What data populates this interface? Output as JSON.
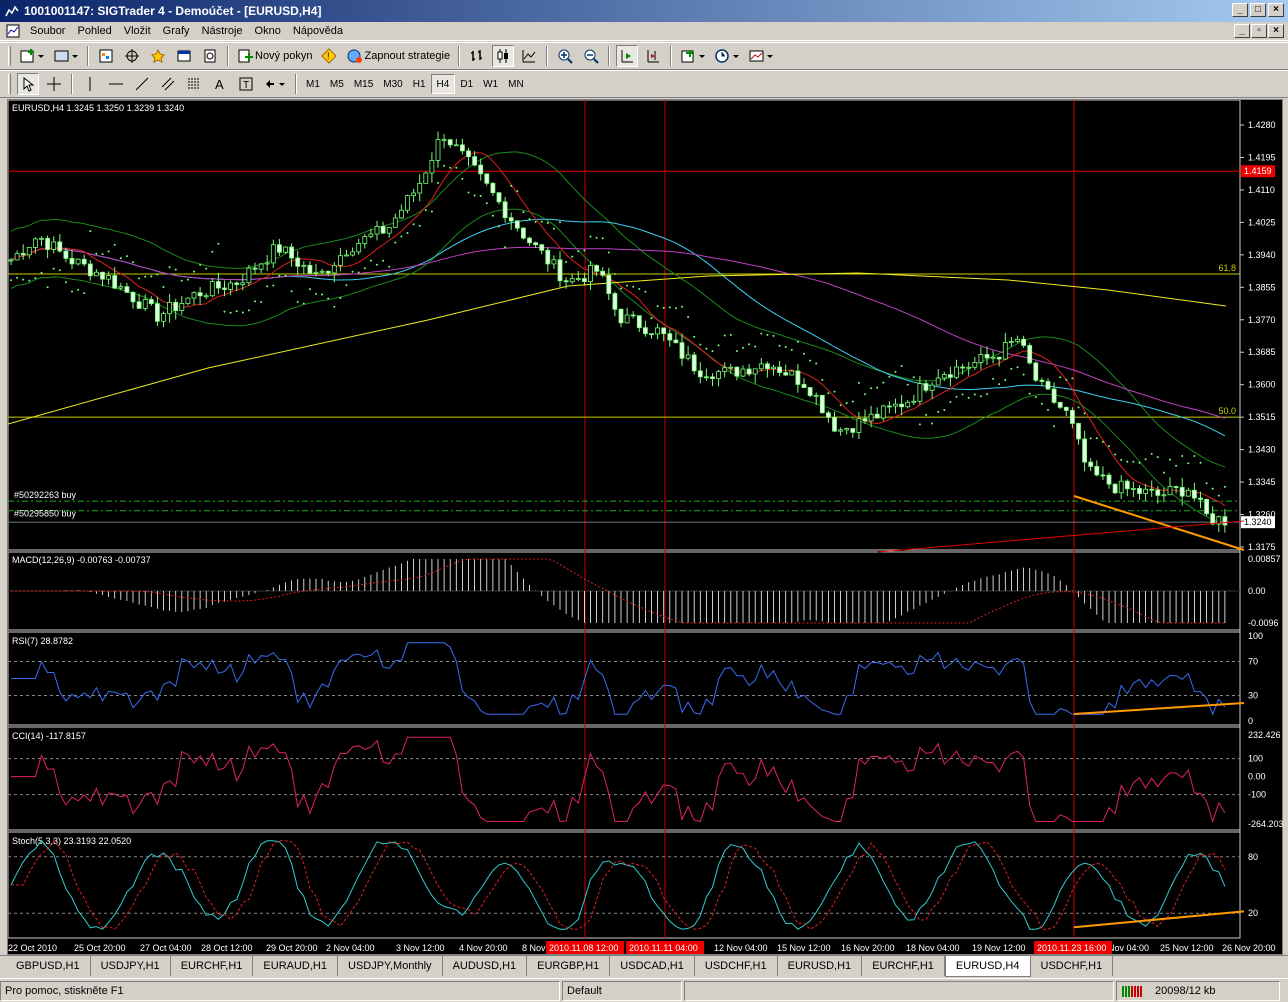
{
  "window": {
    "title": "1001001147: SIGTrader 4 - Demoúčet - [EURUSD,H4]"
  },
  "menu": [
    "Soubor",
    "Pohled",
    "Vložit",
    "Grafy",
    "Nástroje",
    "Okno",
    "Nápověda"
  ],
  "toolbar": {
    "new_order": "Nový pokyn",
    "strategy": "Zapnout strategie"
  },
  "timeframes": [
    "M1",
    "M5",
    "M15",
    "M30",
    "H1",
    "H4",
    "D1",
    "W1",
    "MN"
  ],
  "active_timeframe": "H4",
  "chart": {
    "symbol_header": "EURUSD,H4  1.3245 1.3250 1.3239 1.3240",
    "price_labels": [
      "1.4280",
      "1.4195",
      "1.4110",
      "1.4025",
      "1.3940",
      "1.3855",
      "1.3770",
      "1.3685",
      "1.3600",
      "1.3515",
      "1.3430",
      "1.3345",
      "1.3260",
      "1.3175"
    ],
    "highlight_price": "1.4159",
    "current_price": "1.3240",
    "fib_labels": [
      "61.8",
      "50.0"
    ],
    "orders": [
      "#50292263 buy",
      "#50295850 buy"
    ],
    "macd": {
      "label": "MACD(12,26,9) -0.00763 -0.00737",
      "scale": [
        "0.00857",
        "0.00",
        "-0.0096"
      ]
    },
    "rsi": {
      "label": "RSI(7) 28.8782",
      "scale": [
        "100",
        "70",
        "30",
        "0"
      ]
    },
    "cci": {
      "label": "CCI(14) -117.8157",
      "scale": [
        "232.426",
        "100",
        "0.00",
        "-100",
        "-264.203"
      ]
    },
    "stoch": {
      "label": "Stoch(5,3,3) 23.3193 22.0520",
      "scale": [
        "80",
        "20"
      ]
    },
    "time_labels": [
      "22 Oct 2010",
      "25 Oct 20:00",
      "27 Oct 04:00",
      "28 Oct 12:00",
      "29 Oct 20:00",
      "2 Nov 04:00",
      "3 Nov 12:00",
      "4 Nov 20:00",
      "8 Nov",
      "12 Nov 04:00",
      "15 Nov 12:00",
      "16 Nov 20:00",
      "18 Nov 04:00",
      "19 Nov 12:00",
      "Nov 04:00",
      "25 Nov 12:00",
      "26 Nov 20:00"
    ],
    "time_highlights": [
      "2010.11.08 12:00",
      "2010.11.11 04:00",
      "2010.11.23 16:00"
    ]
  },
  "tabs": [
    "GBPUSD,H1",
    "USDJPY,H1",
    "EURCHF,H1",
    "EURAUD,H1",
    "USDJPY,Monthly",
    "AUDUSD,H1",
    "EURGBP,H1",
    "USDCAD,H1",
    "USDCHF,H1",
    "EURUSD,H1",
    "EURCHF,H1",
    "EURUSD,H4",
    "USDCHF,H1"
  ],
  "active_tab": "EURUSD,H4",
  "status": {
    "help": "Pro pomoc, stiskněte F1",
    "profile": "Default",
    "traffic": "20098/12 kb"
  }
}
